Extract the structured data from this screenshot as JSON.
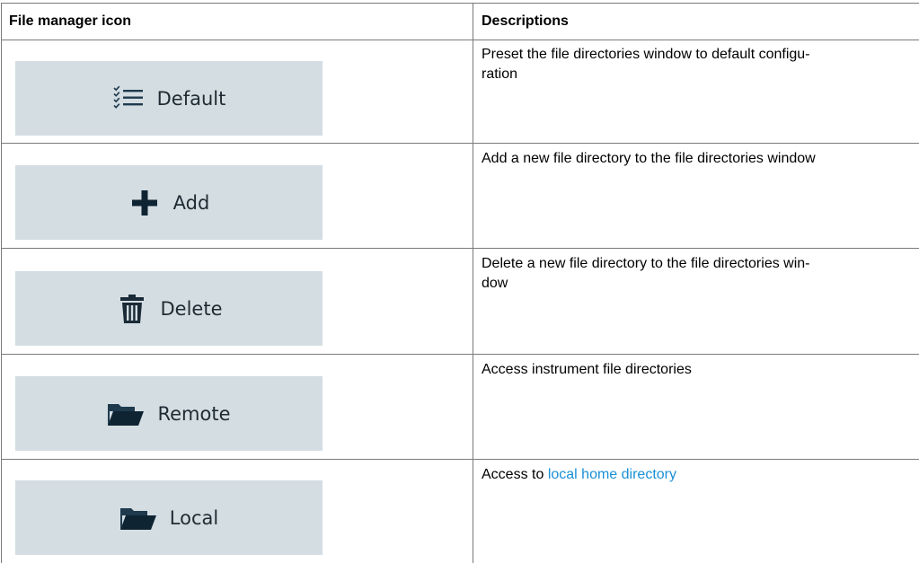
{
  "table": {
    "headers": [
      "File manager icon",
      "Descriptions"
    ],
    "rows": [
      {
        "button_label": "Default",
        "icon": "checklist-icon",
        "description": [
          "Preset the file directories window to default configu-",
          "ration"
        ]
      },
      {
        "button_label": "Add",
        "icon": "plus-icon",
        "description": [
          "Add a new file directory to the file directories window"
        ]
      },
      {
        "button_label": "Delete",
        "icon": "trash-icon",
        "description": [
          "Delete a new file directory to the file directories win-",
          "dow"
        ]
      },
      {
        "button_label": "Remote",
        "icon": "folder-open-icon",
        "description": [
          "Access instrument file directories"
        ]
      },
      {
        "button_label": "Local",
        "icon": "folder-open-icon",
        "description_prefix": "Access to ",
        "description_link": "local home directory"
      }
    ]
  },
  "colors": {
    "button_bg": "#d4dde2",
    "icon_dark": "#1f3a4d",
    "link": "#1a8fd6",
    "rule": "#7a7a7a"
  }
}
